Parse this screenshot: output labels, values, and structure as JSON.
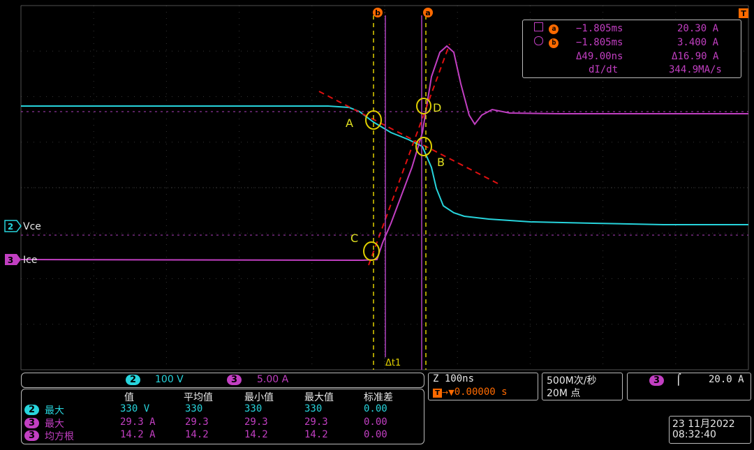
{
  "colors": {
    "ch2": "#27d4dc",
    "ch3": "#c23fc2",
    "cursor": "#e0d000",
    "cursor_b": "#b040c0",
    "tangent": "#e01010",
    "marker": "#ff6a00",
    "grid": "#5a5a5a"
  },
  "cursors": {
    "a_label": "a",
    "b_label": "b",
    "delta_label": "Δt1",
    "trigger_label": "T"
  },
  "channels": {
    "ch2": {
      "num": "2",
      "label": "Vce",
      "scale": "100 V"
    },
    "ch3": {
      "num": "3",
      "label": "Ice",
      "scale": "5.00 A"
    }
  },
  "points": {
    "A": "A",
    "B": "B",
    "C": "C",
    "D": "D"
  },
  "cursor_readout": {
    "a_time": "−1.805ms",
    "a_value": "20.30 A",
    "b_time": "−1.805ms",
    "b_value": "3.400 A",
    "delta_time": "Δ49.00ns",
    "delta_value": "Δ16.90 A",
    "rate_label": "dI/dt",
    "rate_value": "344.9MA/s"
  },
  "measurements": {
    "headers": [
      "值",
      "平均值",
      "最小值",
      "最大值",
      "标准差"
    ],
    "rows": [
      {
        "ch": "2",
        "name": "最大",
        "value": "330 V",
        "mean": "330",
        "min": "330",
        "max": "330",
        "std": "0.00"
      },
      {
        "ch": "3",
        "name": "最大",
        "value": "29.3 A",
        "mean": "29.3",
        "min": "29.3",
        "max": "29.3",
        "std": "0.00"
      },
      {
        "ch": "3",
        "name": "均方根",
        "value": "14.2 A",
        "mean": "14.2",
        "min": "14.2",
        "max": "14.2",
        "std": "0.00"
      }
    ]
  },
  "timebase": {
    "zoom": "Z 100ns",
    "position": "0.00000 s",
    "trigger_glyph": "T"
  },
  "acquisition": {
    "rate": "500M次/秒",
    "points": "20M 点"
  },
  "trigger": {
    "ch": "3",
    "level": "20.0 A"
  },
  "datetime": {
    "date": "23 11月2022",
    "time": "08:32:40"
  }
}
